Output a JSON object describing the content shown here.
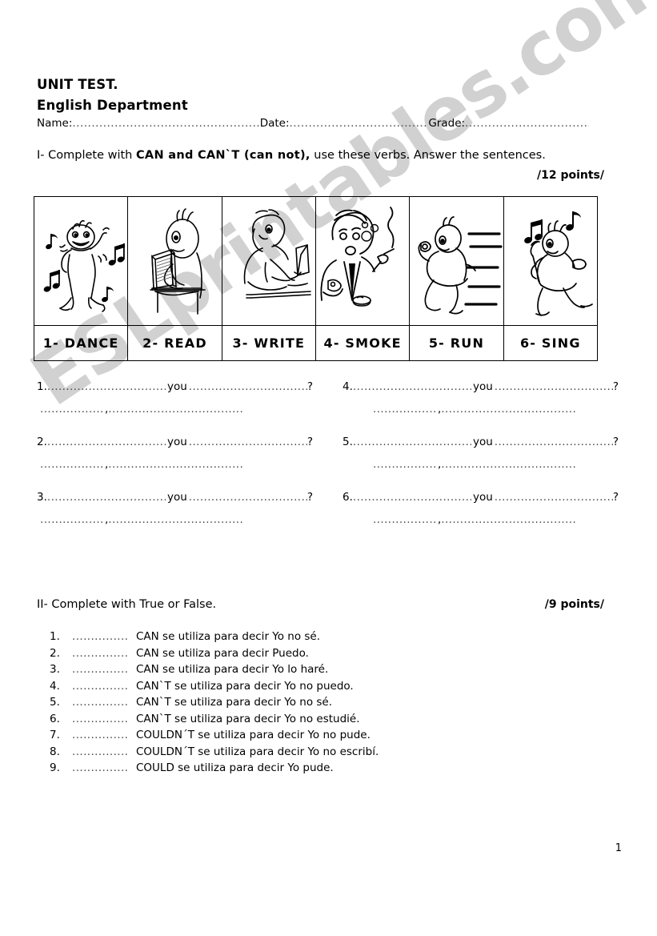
{
  "document": {
    "title": "UNIT TEST.",
    "department": "English Department",
    "page_number": "1",
    "watermark": "ESLprintables.com",
    "watermark_color": "#c9c9c9"
  },
  "header_fields": {
    "name_label": "Name:",
    "date_label": "Date:",
    "grade_label": "Grade:",
    "name_dots": "..............................................................",
    "date_dots": "..............................................",
    "grade_dots": "........................................."
  },
  "section_one": {
    "prefix": "I- Complete with ",
    "bold_part": "CAN and CAN`T (can not),",
    "suffix": " use these verbs. Answer the sentences.",
    "points": "/12 points/",
    "verbs": [
      {
        "label": "1- DANCE",
        "icon": "dancing-person-icon"
      },
      {
        "label": "2- READ",
        "icon": "reading-person-icon"
      },
      {
        "label": "3- WRITE",
        "icon": "writing-person-icon"
      },
      {
        "label": "4- SMOKE",
        "icon": "smoking-person-icon"
      },
      {
        "label": "5- RUN",
        "icon": "running-person-icon"
      },
      {
        "label": "6- SING",
        "icon": "singing-person-icon"
      }
    ],
    "answer_items": [
      {
        "number": "1.",
        "you": "you",
        "question_mark": "?",
        "comma": ","
      },
      {
        "number": "2.",
        "you": "you",
        "question_mark": "?",
        "comma": ","
      },
      {
        "number": "3.",
        "you": "you",
        "question_mark": "?",
        "comma": ","
      },
      {
        "number": "4.",
        "you": "you",
        "question_mark": "?",
        "comma": ","
      },
      {
        "number": "5.",
        "you": "you",
        "question_mark": "?",
        "comma": ","
      },
      {
        "number": "6.",
        "you": "you",
        "question_mark": "?",
        "comma": ","
      }
    ],
    "dots_long": "................................................",
    "dots_medium": "..........................................",
    "dots_short": "...................."
  },
  "section_two": {
    "instruction": "II- Complete with True or False.",
    "points": "/9 points/",
    "blank_dots": "...............",
    "statements": [
      {
        "number": "1.",
        "text": "CAN se utiliza para decir Yo no sé."
      },
      {
        "number": "2.",
        "text": "CAN se utiliza para decir Puedo."
      },
      {
        "number": "3.",
        "text": "CAN se utiliza para decir Yo lo haré."
      },
      {
        "number": "4.",
        "text": "CAN`T se utiliza para decir Yo no puedo."
      },
      {
        "number": "5.",
        "text": "CAN`T se utiliza para decir Yo no sé."
      },
      {
        "number": "6.",
        "text": "CAN`T se utiliza para decir Yo no estudié."
      },
      {
        "number": "7.",
        "text": "COULDN´T se utiliza para decir Yo no pude."
      },
      {
        "number": "8.",
        "text": "COULDN´T se utiliza para decir Yo no escribí."
      },
      {
        "number": "9.",
        "text": "COULD se utiliza para decir Yo pude."
      }
    ]
  }
}
